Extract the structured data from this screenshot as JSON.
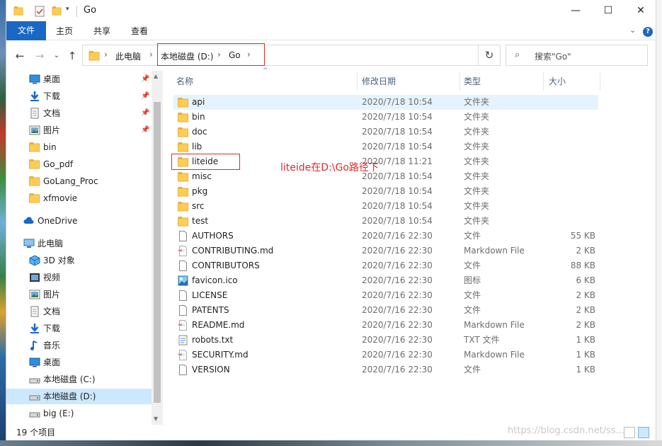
{
  "window": {
    "title": "Go",
    "controls": {
      "minimize": "—",
      "maximize": "☐",
      "close": "✕"
    }
  },
  "ribbon": {
    "tabs": [
      "文件",
      "主页",
      "共享",
      "查看"
    ],
    "help": "?"
  },
  "address": {
    "segments": [
      "此电脑",
      "本地磁盘 (D:)",
      "Go"
    ],
    "separator": "›"
  },
  "search": {
    "placeholder": "搜索\"Go\""
  },
  "nav": {
    "quick_access": [
      {
        "label": "桌面",
        "icon": "desktop-icon",
        "pinned": true
      },
      {
        "label": "下载",
        "icon": "download-icon",
        "pinned": true
      },
      {
        "label": "文档",
        "icon": "documents-icon",
        "pinned": true
      },
      {
        "label": "图片",
        "icon": "pictures-icon",
        "pinned": true
      },
      {
        "label": "bin",
        "icon": "folder-icon"
      },
      {
        "label": "Go_pdf",
        "icon": "folder-icon"
      },
      {
        "label": "GoLang_Proc",
        "icon": "folder-icon"
      },
      {
        "label": "xfmovie",
        "icon": "folder-icon"
      }
    ],
    "onedrive": "OneDrive",
    "this_pc": "此电脑",
    "pc_items": [
      {
        "label": "3D 对象",
        "icon": "3d-objects-icon"
      },
      {
        "label": "视频",
        "icon": "videos-icon"
      },
      {
        "label": "图片",
        "icon": "pictures-icon"
      },
      {
        "label": "文档",
        "icon": "documents-icon"
      },
      {
        "label": "下载",
        "icon": "download-icon"
      },
      {
        "label": "音乐",
        "icon": "music-icon"
      },
      {
        "label": "桌面",
        "icon": "desktop-icon"
      },
      {
        "label": "本地磁盘 (C:)",
        "icon": "drive-icon"
      },
      {
        "label": "本地磁盘 (D:)",
        "icon": "drive-icon",
        "selected": true
      },
      {
        "label": "big (E:)",
        "icon": "drive-icon"
      }
    ]
  },
  "columns": {
    "name": "名称",
    "modified": "修改日期",
    "type": "类型",
    "size": "大小"
  },
  "files": [
    {
      "name": "api",
      "date": "2020/7/18 10:54",
      "type": "文件夹",
      "size": "",
      "icon": "folder-icon"
    },
    {
      "name": "bin",
      "date": "2020/7/18 10:54",
      "type": "文件夹",
      "size": "",
      "icon": "folder-icon"
    },
    {
      "name": "doc",
      "date": "2020/7/18 10:54",
      "type": "文件夹",
      "size": "",
      "icon": "folder-icon"
    },
    {
      "name": "lib",
      "date": "2020/7/18 10:54",
      "type": "文件夹",
      "size": "",
      "icon": "folder-icon"
    },
    {
      "name": "liteide",
      "date": "2020/7/18 11:21",
      "type": "文件夹",
      "size": "",
      "icon": "folder-icon"
    },
    {
      "name": "misc",
      "date": "2020/7/18 10:54",
      "type": "文件夹",
      "size": "",
      "icon": "folder-icon"
    },
    {
      "name": "pkg",
      "date": "2020/7/18 10:54",
      "type": "文件夹",
      "size": "",
      "icon": "folder-icon"
    },
    {
      "name": "src",
      "date": "2020/7/18 10:54",
      "type": "文件夹",
      "size": "",
      "icon": "folder-icon"
    },
    {
      "name": "test",
      "date": "2020/7/18 10:54",
      "type": "文件夹",
      "size": "",
      "icon": "folder-icon"
    },
    {
      "name": "AUTHORS",
      "date": "2020/7/16 22:30",
      "type": "文件",
      "size": "55 KB",
      "icon": "file-icon"
    },
    {
      "name": "CONTRIBUTING.md",
      "date": "2020/7/16 22:30",
      "type": "Markdown File",
      "size": "2 KB",
      "icon": "markdown-icon"
    },
    {
      "name": "CONTRIBUTORS",
      "date": "2020/7/16 22:30",
      "type": "文件",
      "size": "88 KB",
      "icon": "file-icon"
    },
    {
      "name": "favicon.ico",
      "date": "2020/7/16 22:30",
      "type": "图标",
      "size": "6 KB",
      "icon": "image-icon"
    },
    {
      "name": "LICENSE",
      "date": "2020/7/16 22:30",
      "type": "文件",
      "size": "2 KB",
      "icon": "file-icon"
    },
    {
      "name": "PATENTS",
      "date": "2020/7/16 22:30",
      "type": "文件",
      "size": "2 KB",
      "icon": "file-icon"
    },
    {
      "name": "README.md",
      "date": "2020/7/16 22:30",
      "type": "Markdown File",
      "size": "2 KB",
      "icon": "markdown-icon"
    },
    {
      "name": "robots.txt",
      "date": "2020/7/16 22:30",
      "type": "TXT 文件",
      "size": "1 KB",
      "icon": "text-file-icon"
    },
    {
      "name": "SECURITY.md",
      "date": "2020/7/16 22:30",
      "type": "Markdown File",
      "size": "1 KB",
      "icon": "markdown-icon"
    },
    {
      "name": "VERSION",
      "date": "2020/7/16 22:30",
      "type": "文件",
      "size": "1 KB",
      "icon": "file-icon"
    }
  ],
  "annotation": {
    "text": "liteide在D:\\Go路径下",
    "color": "#e02a2a"
  },
  "status": {
    "count": "19 个项目"
  },
  "watermark": "https://blog.csdn.net/ss...",
  "colors": {
    "accent": "#1a67c4",
    "selection": "#cce8ff",
    "hover": "#e5f3ff",
    "folder": "#ffcc55"
  }
}
